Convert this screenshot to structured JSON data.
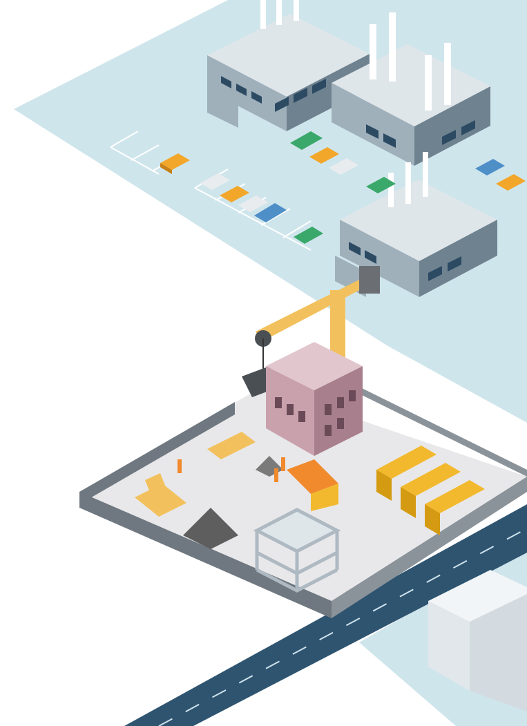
{
  "scene": {
    "description_visible_text": "",
    "palette": {
      "ground_blue": "#cfe5ec",
      "ground_blue_light": "#dcedf2",
      "factory_roof": "#dfe6ea",
      "factory_wall": "#9fb0bb",
      "factory_wall_dark": "#6f8290",
      "window": "#2d4a63",
      "site_slab": "#e8e8ea",
      "site_wall": "#6f7880",
      "road": "#2e5470",
      "road_dash": "#cfe3ec",
      "building_pink": "#c9a1ad",
      "building_pink_dark": "#a87f8c",
      "crane_yellow": "#f2c15d",
      "crane_olive": "#7a6a2c",
      "container_yellow": "#f2b92e",
      "truck_orange": "#f08a2d",
      "dirt": "#5e5e5e",
      "car_colors": [
        "#f2a72a",
        "#f2a72a",
        "#e9ecef",
        "#4e8fc7",
        "#3aa86a"
      ]
    },
    "icons": [
      "factory-icon",
      "crane-icon",
      "truck-icon",
      "bulldozer-icon",
      "car-icon",
      "worker-icon"
    ]
  }
}
